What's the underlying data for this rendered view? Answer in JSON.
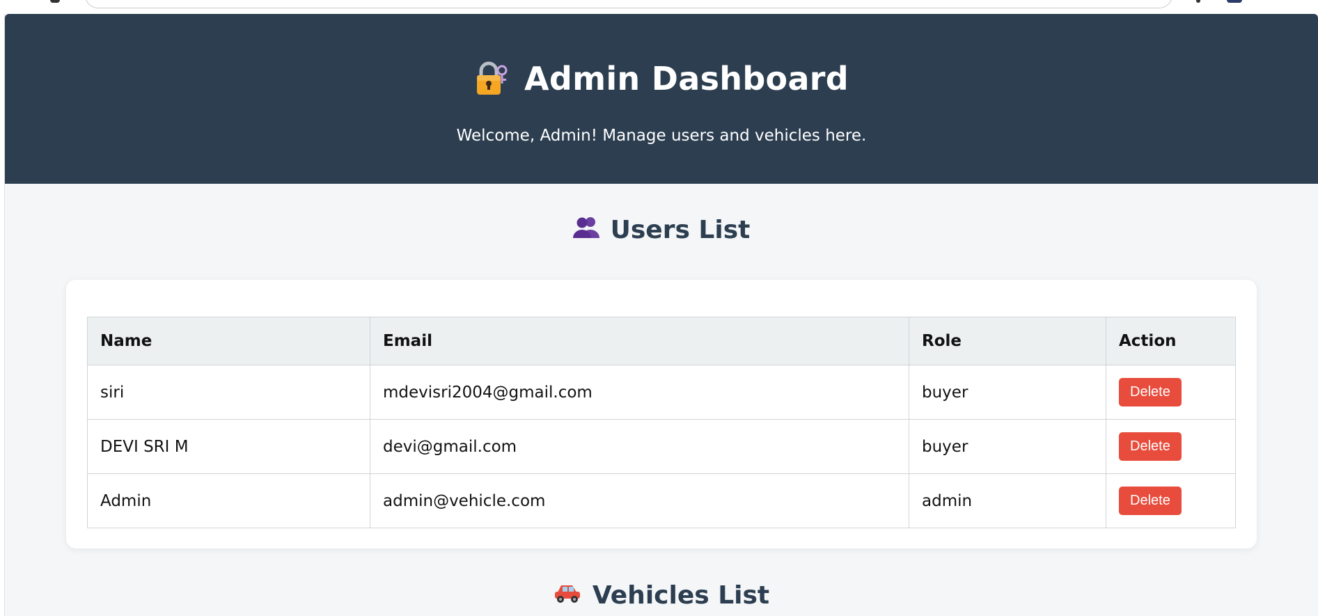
{
  "header": {
    "icon": "locked-with-key-icon",
    "title": "Admin Dashboard",
    "subtitle": "Welcome, Admin! Manage users and vehicles here."
  },
  "users_section": {
    "icon": "busts-in-silhouette-icon",
    "title": "Users List",
    "columns": [
      "Name",
      "Email",
      "Role",
      "Action"
    ],
    "rows": [
      {
        "name": "siri",
        "email": "mdevisri2004@gmail.com",
        "role": "buyer",
        "action": "Delete"
      },
      {
        "name": "DEVI SRI M",
        "email": "devi@gmail.com",
        "role": "buyer",
        "action": "Delete"
      },
      {
        "name": "Admin",
        "email": "admin@vehicle.com",
        "role": "admin",
        "action": "Delete"
      }
    ]
  },
  "vehicles_section": {
    "icon": "car-icon",
    "title": "Vehicles List"
  },
  "colors": {
    "header_bg": "#2c3e50",
    "page_bg": "#f4f6f8",
    "delete_button": "#e74c3c",
    "table_header_bg": "#ecf0f1"
  }
}
